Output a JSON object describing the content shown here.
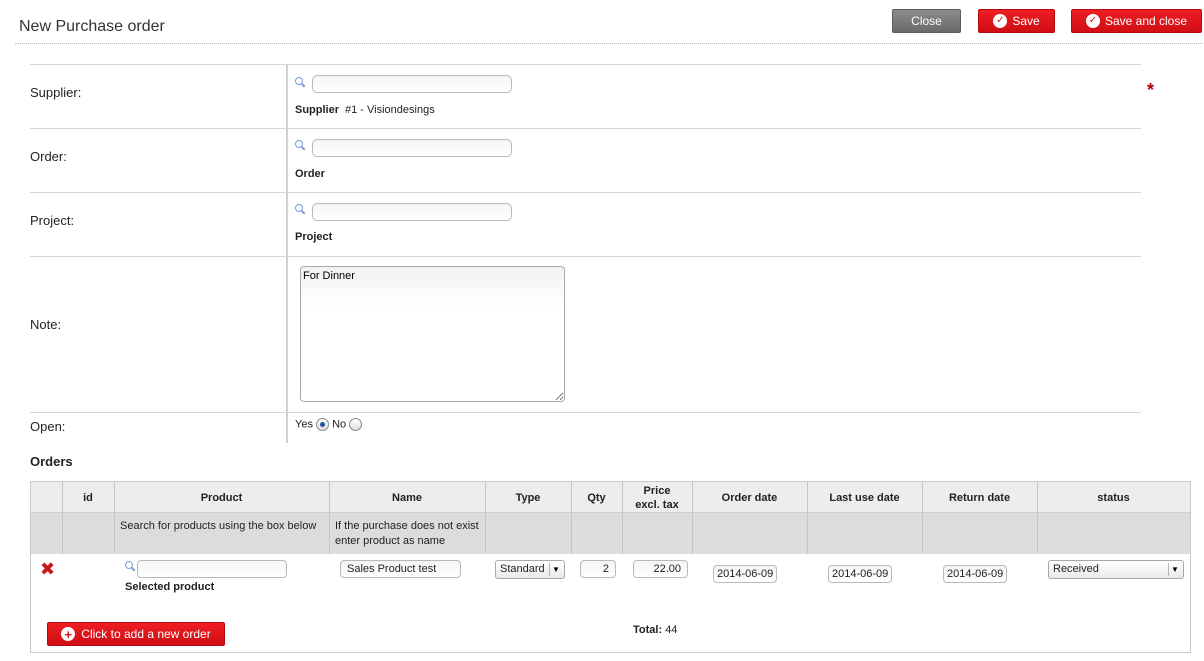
{
  "header": {
    "title": "New Purchase order",
    "close_label": "Close",
    "save_label": "Save",
    "save_close_label": "Save and close"
  },
  "form": {
    "supplier": {
      "label": "Supplier:",
      "search_value": "",
      "sublabel": "Supplier",
      "subvalue": "#1 - Visiondesings"
    },
    "order": {
      "label": "Order:",
      "search_value": "",
      "sublabel": "Order"
    },
    "project": {
      "label": "Project:",
      "search_value": "",
      "sublabel": "Project"
    },
    "note": {
      "label": "Note:",
      "value": "For Dinner"
    },
    "open": {
      "label": "Open:",
      "yes_label": "Yes",
      "no_label": "No",
      "selected": "Yes"
    },
    "required_marker": "*"
  },
  "orders": {
    "title": "Orders",
    "columns": [
      "id",
      "Product",
      "Name",
      "Type",
      "Qty",
      "Price excl. tax",
      "Order date",
      "Last use date",
      "Return date",
      "status"
    ],
    "hints": {
      "product": "Search for products using the box below",
      "name": "If the purchase does not exist enter product as name"
    },
    "rows": [
      {
        "product_search": "",
        "product_label": "Selected product",
        "name": "Sales Product test",
        "type": "Standard",
        "qty": "2",
        "price": "22.00",
        "order_date": "2014-06-09",
        "last_use_date": "2014-06-09",
        "return_date": "2014-06-09",
        "status": "Received"
      }
    ],
    "add_button_label": "Click to add a new order",
    "total_label": "Total:",
    "total_value": "44"
  },
  "colors": {
    "accent": "#d8131a",
    "grey_button": "#7a7a7a",
    "header_bg": "#ededed"
  },
  "icons": [
    "search-icon",
    "check-icon",
    "delete-icon",
    "plus-icon",
    "chevron-down-icon"
  ]
}
